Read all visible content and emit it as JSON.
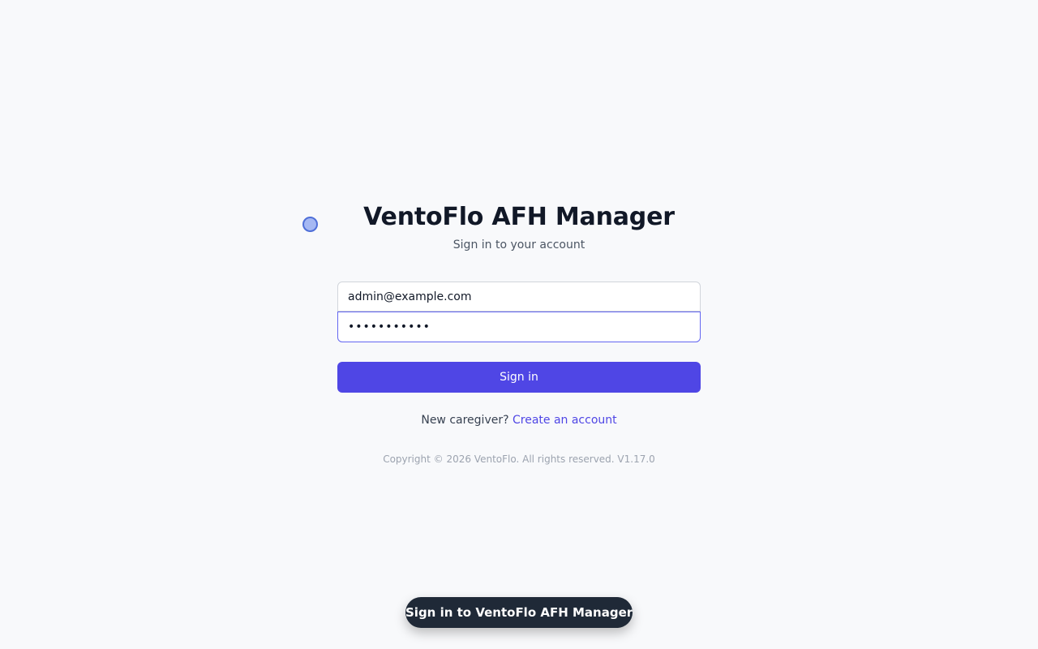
{
  "app": {
    "title": "VentoFlo AFH Manager",
    "subtitle": "Sign in to your account"
  },
  "login_form": {
    "email_value": "admin@example.com",
    "password_value": "•••••••••••",
    "sign_in_label": "Sign in"
  },
  "signup": {
    "prompt": "New caregiver?",
    "link_label": "Create an account"
  },
  "footer": {
    "copyright": "Copyright © 2026 VentoFlo. All rights reserved. V1.17.0"
  },
  "toast": {
    "message": "Sign in to VentoFlo AFH Manager"
  },
  "colors": {
    "background": "#f8f9fb",
    "accent": "#4f46e5",
    "focus_border": "#6366f1",
    "toast_bg": "#1f2937"
  }
}
